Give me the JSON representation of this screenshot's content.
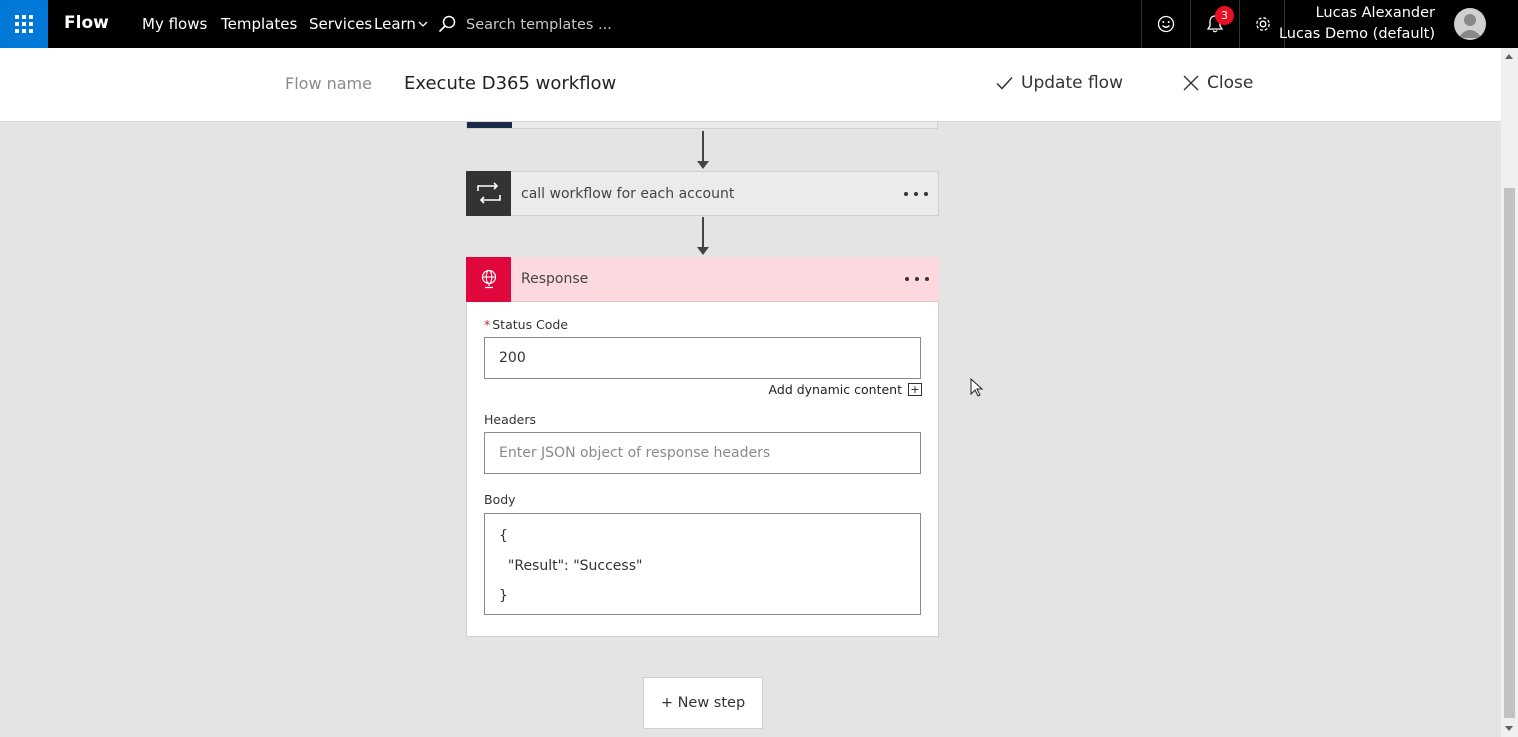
{
  "app": {
    "brand": "Flow",
    "nav": [
      "My flows",
      "Templates",
      "Services",
      "Learn"
    ],
    "search_placeholder": "Search templates ...",
    "notification_count": "3",
    "user_name": "Lucas Alexander",
    "environment": "Lucas Demo (default)",
    "icons": {
      "waffle": "waffle-icon",
      "search": "search-icon",
      "feedback": "smiley-icon",
      "notifications": "bell-icon",
      "settings": "gear-icon",
      "avatar": "person-icon"
    }
  },
  "header": {
    "flow_name_label": "Flow name",
    "flow_name": "Execute D365 workflow",
    "update_label": "Update flow",
    "close_label": "Close"
  },
  "steps": {
    "apply_each": {
      "title": "call workflow for each account",
      "icon": "loop-icon"
    },
    "response": {
      "title": "Response",
      "icon": "globe-icon",
      "accent": "#e0073c",
      "status_label": "Status Code",
      "status_required": "*",
      "status_value": "200",
      "dynamic_content": "Add dynamic content",
      "headers_label": "Headers",
      "headers_placeholder": "Enter JSON object of response headers",
      "body_label": "Body",
      "body_lines": [
        "{",
        "  \"Result\": \"Success\"",
        "}"
      ]
    }
  },
  "new_step_label": "+ New step",
  "colors": {
    "brand_blue": "#0078d7",
    "topbar": "#000000",
    "badge": "#e81123"
  }
}
